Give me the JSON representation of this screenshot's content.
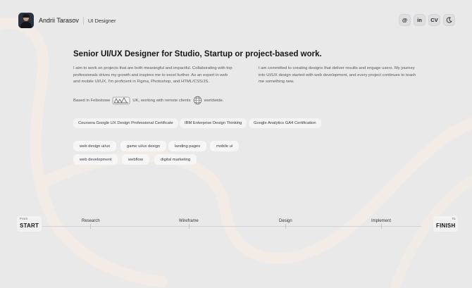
{
  "header": {
    "name": "Andrii Tarasov",
    "role": "UI Designer",
    "social": [
      {
        "id": "email",
        "label": "@",
        "icon": "at-icon"
      },
      {
        "id": "linkedin",
        "label": "in",
        "icon": "linkedin-icon"
      },
      {
        "id": "cv",
        "label": "CV",
        "icon": "cv-icon"
      },
      {
        "id": "theme",
        "label": "",
        "icon": "moon-icon"
      }
    ]
  },
  "main": {
    "title": "Senior UI/UX Designer for Studio, Startup or project-based work.",
    "paragraph_left": "I aim to work on projects that are both meaningful and impactful. Collaborating with top professionals drives my growth and inspires me to excel further. As an expert in web and mobile UI/UX, I'm proficient in Figma, Photoshop, and HTML/CSS/JS.",
    "paragraph_right": "I am committed to creating designs that deliver results and engage users. My journey into UI/UX design started with web development, and every project continues to teach me something new.",
    "based": {
      "prefix": "Based in Felixstowe",
      "middle": "UK, working with remote clients",
      "suffix": "worldwide."
    },
    "certificates": [
      "Coursera Google UX Design Professional Certificate",
      "IBM Enterprise Design Thinking",
      "Google Analytics GA4 Certification"
    ],
    "tags": [
      "web design ui/ux",
      "game ui/ux design",
      "landing pages",
      "mobile ui",
      "web development",
      "webflow",
      "digital marketing"
    ]
  },
  "timeline": {
    "start_small": "From",
    "start_big": "START",
    "end_small": "To",
    "end_big": "FINISH",
    "stages": [
      "Research",
      "Wireframe",
      "Design",
      "Implement"
    ]
  },
  "colors": {
    "background": "#e9e9ea",
    "swirl": "#f3ece6",
    "chip": "#f4f4f5",
    "text": "#1b1b1d",
    "muted": "#58585c"
  }
}
